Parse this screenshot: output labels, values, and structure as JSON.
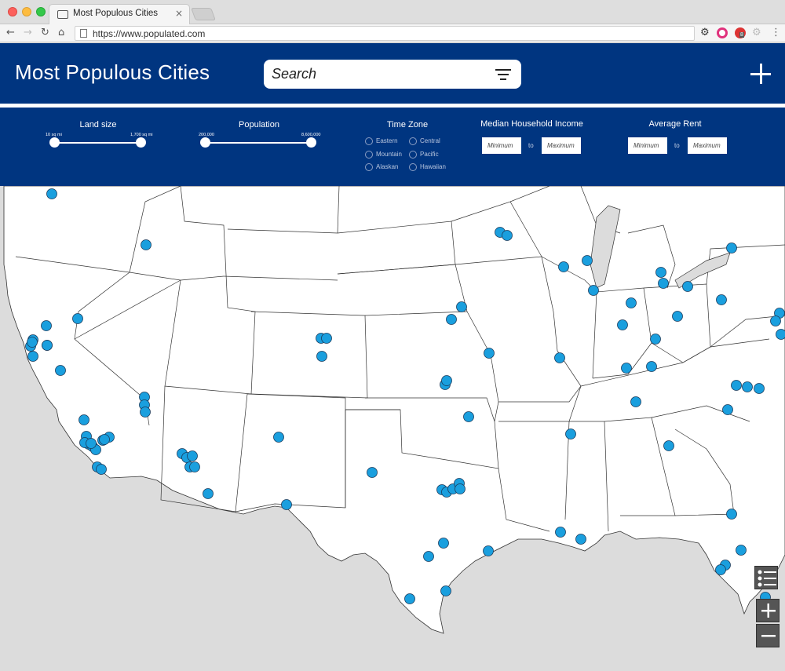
{
  "browser": {
    "tab_title": "Most Populous Cities",
    "tab_close": "×",
    "url": "https://www.populated.com",
    "extension_badge": "8"
  },
  "header": {
    "title": "Most Populous Cities",
    "search_placeholder": "Search"
  },
  "filters": {
    "land_size": {
      "label": "Land size",
      "min_label": "10 sq mi",
      "max_label": "1,700 sq mi"
    },
    "population": {
      "label": "Population",
      "min_label": "200,000",
      "max_label": "8,600,000"
    },
    "time_zone": {
      "label": "Time Zone",
      "options": [
        "Eastern",
        "Central",
        "Mountain",
        "Pacific",
        "Alaskan",
        "Hawaiian"
      ]
    },
    "median_income": {
      "label": "Median Household Income",
      "min_placeholder": "Minimum",
      "max_placeholder": "Maximum",
      "to": "to"
    },
    "average_rent": {
      "label": "Average Rent",
      "min_placeholder": "Minimum",
      "max_placeholder": "Maximum",
      "to": "to"
    }
  },
  "map": {
    "marker_color": "#1a9fde",
    "marker_count": 97
  },
  "colors": {
    "brand_navy": "#003580",
    "map_land": "#ffffff",
    "map_background": "#dcdcdc"
  }
}
